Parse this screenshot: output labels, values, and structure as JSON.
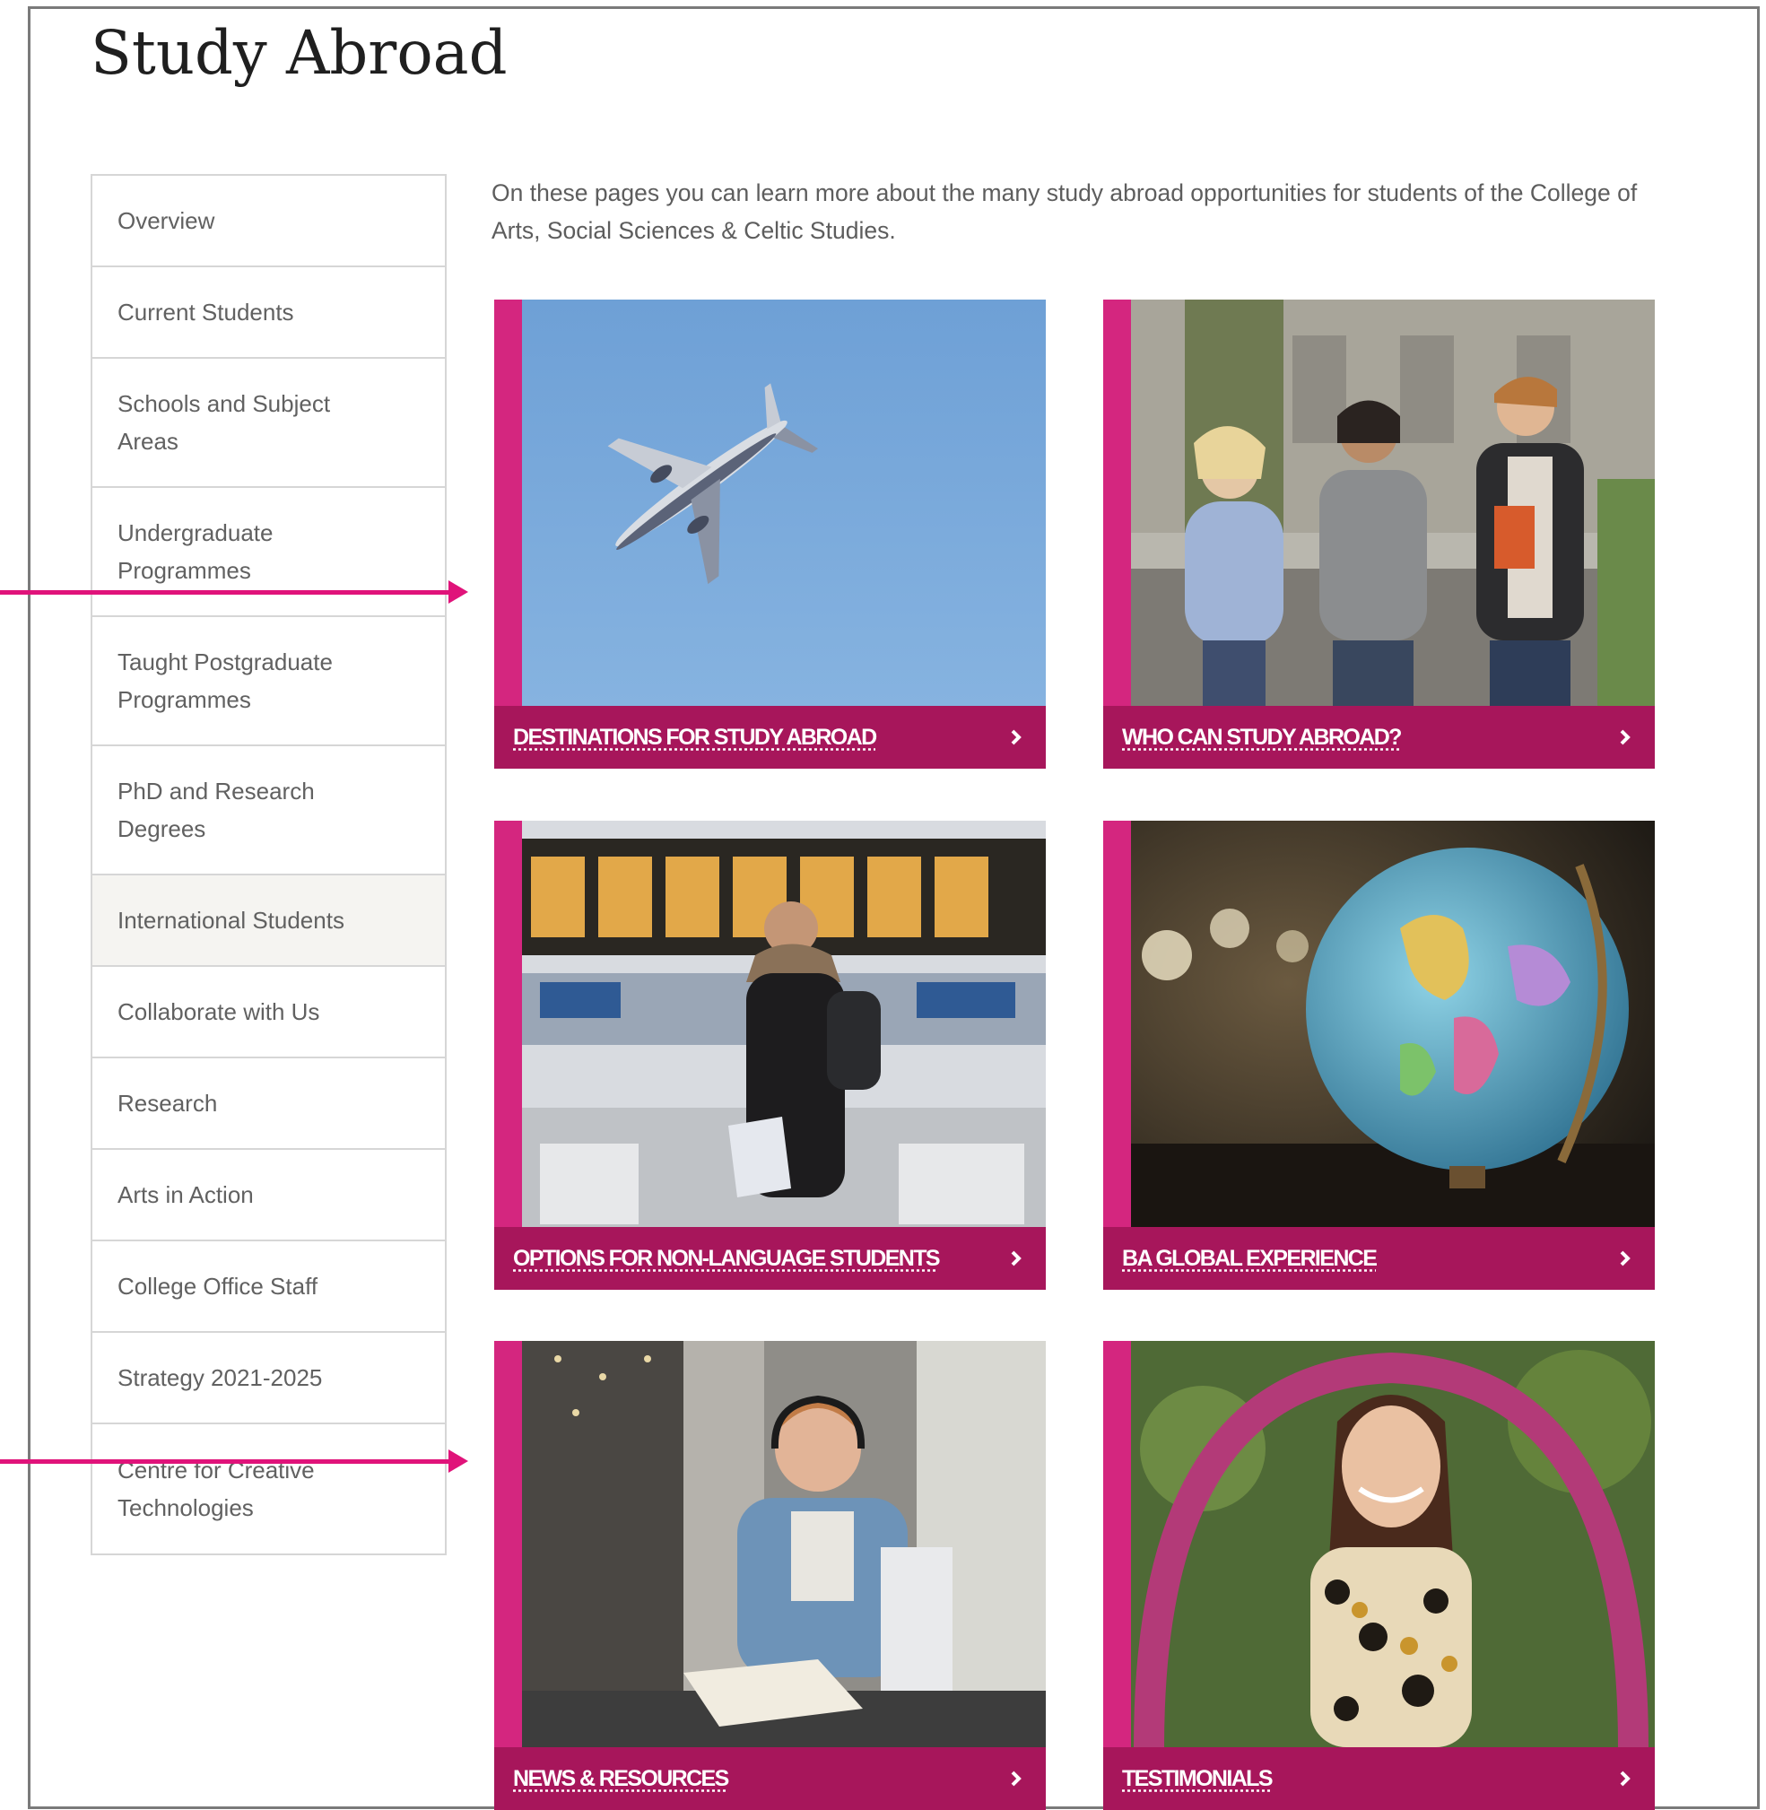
{
  "page_title": "Study Abroad",
  "intro": "On these pages you can learn more about the many study abroad opportunities for students of the College of Arts, Social Sciences & Celtic Studies.",
  "sidebar": {
    "items": [
      {
        "label": "Overview"
      },
      {
        "label": "Current Students"
      },
      {
        "label": "Schools and Subject Areas"
      },
      {
        "label": "Undergraduate Programmes"
      },
      {
        "label": "Taught Postgraduate Programmes"
      },
      {
        "label": "PhD and Research Degrees"
      },
      {
        "label": "International Students",
        "active": true
      },
      {
        "label": "Collaborate with Us"
      },
      {
        "label": "Research"
      },
      {
        "label": "Arts in Action"
      },
      {
        "label": "College Office Staff"
      },
      {
        "label": "Strategy 2021-2025"
      },
      {
        "label": "Centre for Creative Technologies"
      }
    ]
  },
  "cards": [
    {
      "label": "DESTINATIONS FOR STUDY ABROAD",
      "icon": "chevron-right-icon",
      "image": "airplane-photo"
    },
    {
      "label": "WHO CAN STUDY ABROAD?",
      "icon": "chevron-right-icon",
      "image": "students-walking-photo"
    },
    {
      "label": "OPTIONS FOR NON-LANGUAGE STUDENTS",
      "icon": "chevron-right-icon",
      "image": "airport-traveller-photo"
    },
    {
      "label": "BA GLOBAL EXPERIENCE",
      "icon": "chevron-right-icon",
      "image": "globe-photo"
    },
    {
      "label": "NEWS & RESOURCES",
      "icon": "chevron-right-icon",
      "image": "student-laptop-photo"
    },
    {
      "label": "TESTIMONIALS",
      "icon": "chevron-right-icon",
      "image": "student-portrait-photo"
    }
  ],
  "colors": {
    "accent": "#c81f7c",
    "label_bar": "#a7165b",
    "annotation_arrow": "#e0137a",
    "border": "#d6d6d6",
    "active_item_bg": "#f5f4f1"
  }
}
